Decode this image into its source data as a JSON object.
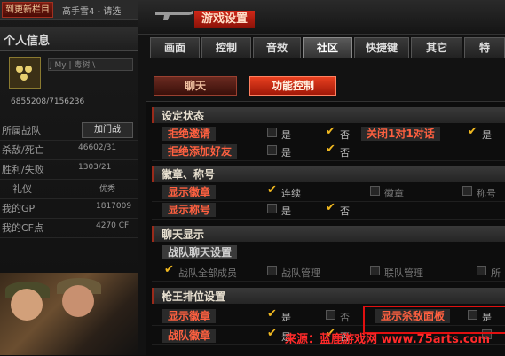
{
  "left_panel": {
    "top_tab": "到更新栏目",
    "top_text": "高手雪4 - 请选",
    "header": "个人信息",
    "rank_text": "J My | 毒树 \\",
    "exp_text": "6855208/7156236",
    "rows": [
      {
        "key": "所属战队",
        "value": ""
      },
      {
        "key": "杀敌/死亡",
        "value": "46602/31"
      },
      {
        "key": "胜利/失败",
        "value": "1303/21"
      },
      {
        "key": "礼仪",
        "value": "优秀"
      },
      {
        "key": "我的GP",
        "value": "1817009"
      },
      {
        "key": "我的CF点",
        "value": "4270 CF"
      }
    ],
    "join_button": "加门战"
  },
  "dialog": {
    "title": "游戏设置",
    "tabs": [
      "画面",
      "控制",
      "音效",
      "社区",
      "快捷键",
      "其它",
      "特"
    ],
    "active_tab": "社区",
    "sub_buttons": [
      "聊天",
      "功能控制"
    ],
    "sections": {
      "s1": "设定状态",
      "s2": "徽章、称号",
      "s3": "聊天显示",
      "s4": "枪王排位设置"
    },
    "rows": {
      "reject_invite": "拒绝邀请",
      "reject_friend": "拒绝添加好友",
      "close_1v1": "关闭1对1对话",
      "show_badge": "显示徽章",
      "show_title": "显示称号",
      "team_chat": "战队聊天设置",
      "rank_badge": "显示徽章",
      "rank_team": "战队徽章",
      "kill_panel": "显示杀敌面板"
    },
    "options": {
      "yes": "是",
      "no": "否",
      "continuous": "连续",
      "badge": "徽章",
      "title_opt": "称号",
      "all_members": "战队全部成员",
      "team_manage": "战队管理",
      "alliance_manage": "联队管理",
      "other": "所"
    },
    "watermark": "来源：蓝鹿游戏网 www.75arts.com"
  },
  "colors": {
    "accent_red": "#e01010",
    "check": "#f0b820"
  }
}
